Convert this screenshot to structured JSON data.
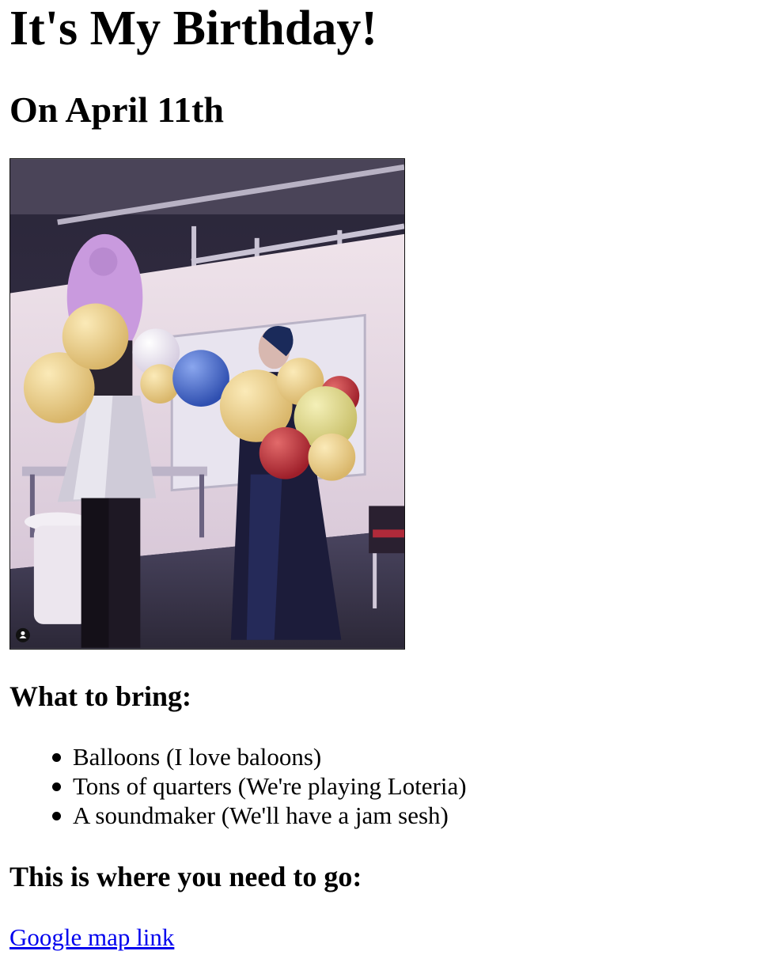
{
  "heading": "It's My Birthday!",
  "subheading": "On April 11th",
  "photo": {
    "subject": "two people holding balloons in a backstage room",
    "overlay_icon": "user-icon"
  },
  "bring": {
    "title": "What to bring:",
    "items": [
      "Balloons (I love baloons)",
      "Tons of quarters (We're playing Loteria)",
      "A soundmaker (We'll have a jam sesh)"
    ]
  },
  "where": {
    "title": "This is where you need to go:",
    "link_label": "Google map link"
  },
  "colors": {
    "link": "#0000ee",
    "text": "#000000",
    "background": "#ffffff"
  }
}
